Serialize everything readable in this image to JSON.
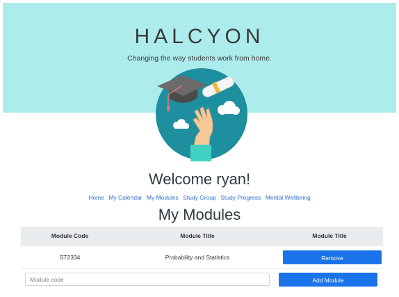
{
  "header": {
    "brand": "HALCYON",
    "tagline": "Changing the way students work from home."
  },
  "welcome": "Welcome ryan!",
  "nav": [
    "Home",
    "My Calendar",
    "My Modules",
    "Study Group",
    "Study Progress",
    "Mental Wellbeing"
  ],
  "section_title": "My Modules",
  "table": {
    "headers": [
      "Module Code",
      "Module Title",
      "Module Title"
    ],
    "rows": [
      {
        "code": "ST2334",
        "title": "Probability and Statistics",
        "action": "Remove"
      }
    ]
  },
  "form": {
    "input_placeholder": "Module code",
    "input_value": "",
    "add_label": "Add Module"
  },
  "colors": {
    "hero_bg": "#adecec",
    "accent": "#1a73e8",
    "link": "#2f6fd0",
    "logo_circle": "#1e8f9e"
  }
}
